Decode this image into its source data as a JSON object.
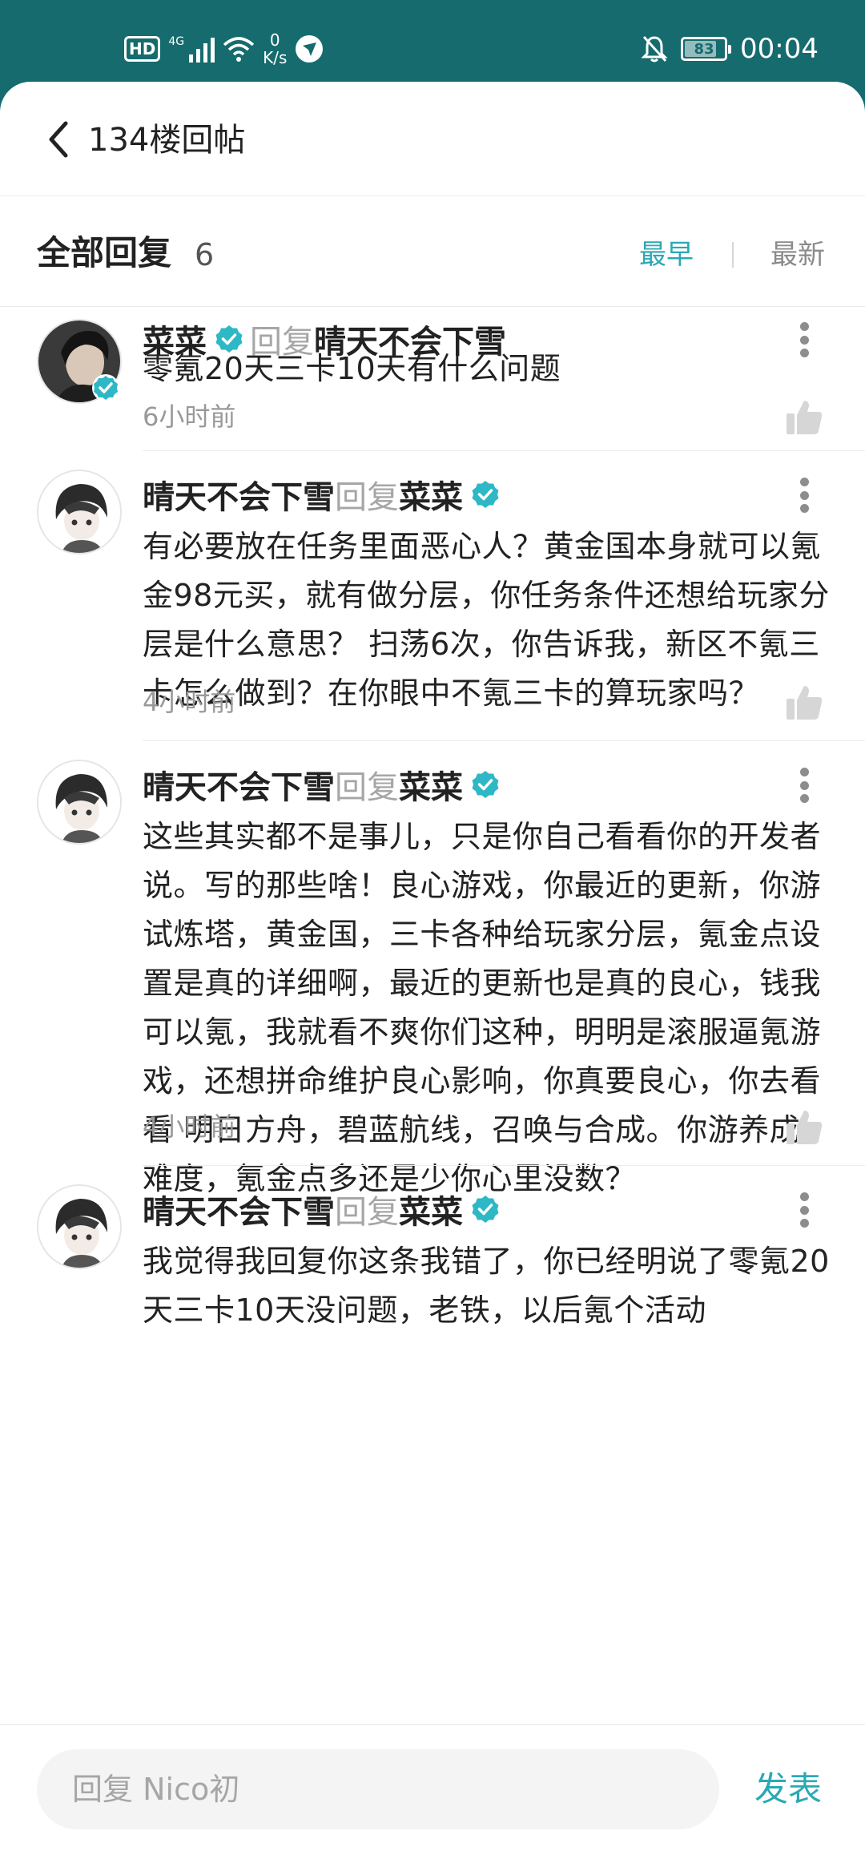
{
  "status_bar": {
    "hd_label": "HD",
    "signal_label": "4G",
    "net_speed_value": "0",
    "net_speed_unit": "K/s",
    "battery_level": "83",
    "time": "00:04",
    "icons": [
      "hd-icon",
      "signal-icon",
      "wifi-icon",
      "net-speed",
      "vpn-icon",
      "mute-bell-icon",
      "battery-icon"
    ]
  },
  "header": {
    "back_icon": "chevron-left-icon",
    "title": "134楼回帖"
  },
  "sort_bar": {
    "title": "全部回复",
    "count": "6",
    "earliest_label": "最早",
    "latest_label": "最新",
    "active": "earliest"
  },
  "replies": [
    {
      "author": "菜菜",
      "author_verified": true,
      "reply_word": "回复",
      "target": "晴天不会下雪",
      "target_verified": false,
      "body": "零氪20天三卡10天有什么问题",
      "time": "6小时前"
    },
    {
      "author": "晴天不会下雪",
      "author_verified": false,
      "reply_word": "回复",
      "target": "菜菜",
      "target_verified": true,
      "body": "有必要放在任务里面恶心人？黄金国本身就可以氪金98元买，就有做分层，你任务条件还想给玩家分层是什么意思？ 扫荡6次，你告诉我，新区不氪三卡怎么做到？在你眼中不氪三卡的算玩家吗？",
      "time": "4小时前"
    },
    {
      "author": "晴天不会下雪",
      "author_verified": false,
      "reply_word": "回复",
      "target": "菜菜",
      "target_verified": true,
      "body": "这些其实都不是事儿，只是你自己看看你的开发者说。写的那些啥！良心游戏，你最近的更新，你游试炼塔，黄金国，三卡各种给玩家分层，氪金点设置是真的详细啊，最近的更新也是真的良心，钱我可以氪，我就看不爽你们这种，明明是滚服逼氪游戏，还想拼命维护良心影响，你真要良心，你去看看 明日方舟，碧蓝航线，召唤与合成。你游养成难度，氪金点多还是少你心里没数？",
      "time": "4小时前"
    },
    {
      "author": "晴天不会下雪",
      "author_verified": false,
      "reply_word": "回复",
      "target": "菜菜",
      "target_verified": true,
      "body": "我觉得我回复你这条我错了，你已经明说了零氪20天三卡10天没问题，老铁，以后氪个活动",
      "time": ""
    }
  ],
  "bottom_bar": {
    "input_placeholder": "回复 Nico初",
    "input_value": "",
    "publish_label": "发表"
  },
  "colors": {
    "status_bar_bg": "#156b6d",
    "accent": "#2aa9b5",
    "verified_badge": "#2eb8c6",
    "muted_text": "#999999"
  }
}
